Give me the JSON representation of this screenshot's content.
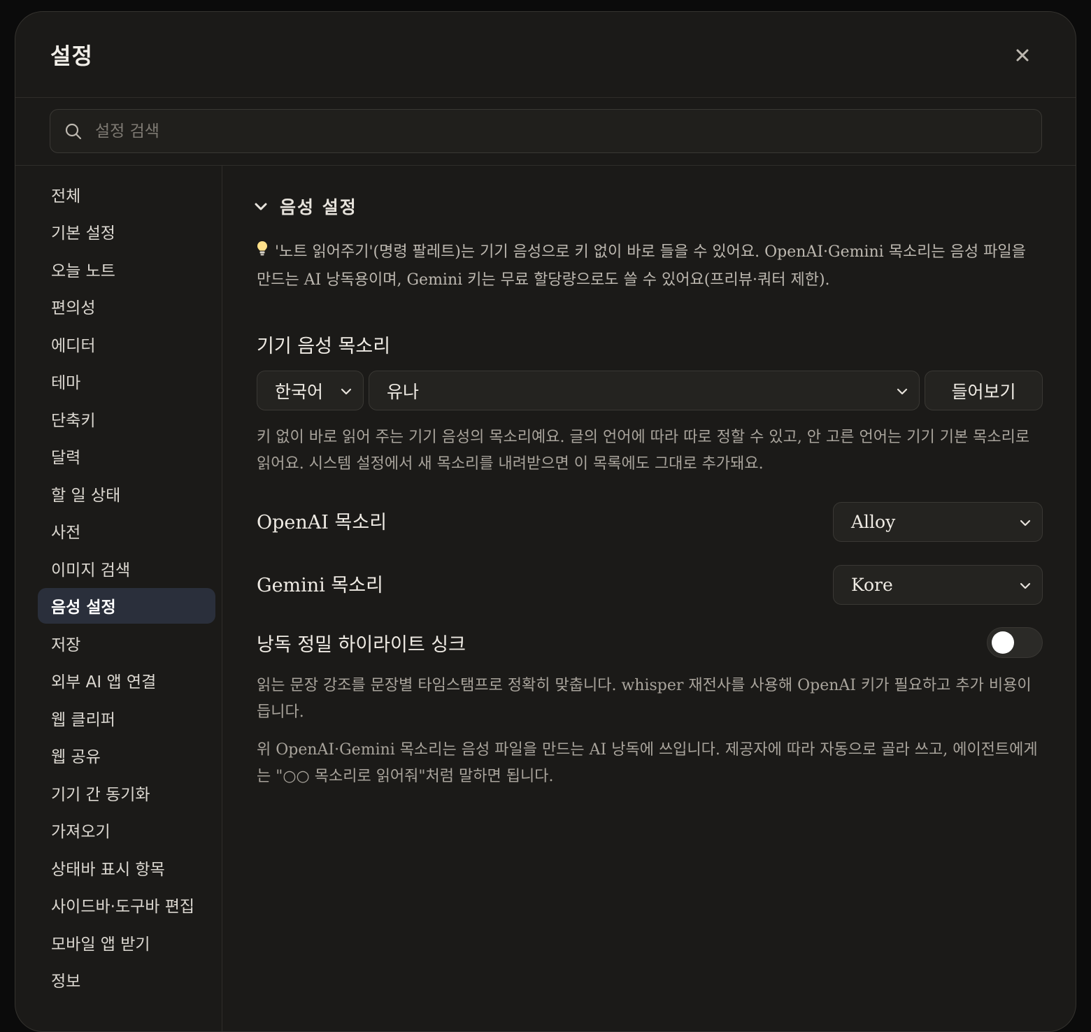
{
  "header": {
    "title": "설정"
  },
  "search": {
    "placeholder": "설정 검색"
  },
  "sidebar": {
    "items": [
      {
        "label": "전체"
      },
      {
        "label": "기본 설정"
      },
      {
        "label": "오늘 노트"
      },
      {
        "label": "편의성"
      },
      {
        "label": "에디터"
      },
      {
        "label": "테마"
      },
      {
        "label": "단축키"
      },
      {
        "label": "달력"
      },
      {
        "label": "할 일 상태"
      },
      {
        "label": "사전"
      },
      {
        "label": "이미지 검색"
      },
      {
        "label": "음성 설정"
      },
      {
        "label": "저장"
      },
      {
        "label": "외부 AI 앱 연결"
      },
      {
        "label": "웹 클리퍼"
      },
      {
        "label": "웹 공유"
      },
      {
        "label": "기기 간 동기화"
      },
      {
        "label": "가져오기"
      },
      {
        "label": "상태바 표시 항목"
      },
      {
        "label": "사이드바·도구바 편집"
      },
      {
        "label": "모바일 앱 받기"
      },
      {
        "label": "정보"
      }
    ],
    "active_index": 11
  },
  "content": {
    "section_title": "음성 설정",
    "tip": "'노트 읽어주기'(명령 팔레트)는 기기 음성으로 키 없이 바로 들을 수 있어요. OpenAI·Gemini 목소리는 음성 파일을 만드는 AI 낭독용이며, Gemini 키는 무료 할당량으로도 쓸 수 있어요(프리뷰·쿼터 제한).",
    "device_voice": {
      "label": "기기 음성 목소리",
      "language": "한국어",
      "voice": "유나",
      "preview_button": "들어보기",
      "description": "키 없이 바로 읽어 주는 기기 음성의 목소리예요. 글의 언어에 따라 따로 정할 수 있고, 안 고른 언어는 기기 기본 목소리로 읽어요. 시스템 설정에서 새 목소리를 내려받으면 이 목록에도 그대로 추가돼요."
    },
    "openai_voice": {
      "label": "OpenAI 목소리",
      "value": "Alloy"
    },
    "gemini_voice": {
      "label": "Gemini 목소리",
      "value": "Kore"
    },
    "highlight_sync": {
      "label": "낭독 정밀 하이라이트 싱크",
      "enabled": false,
      "description": "읽는 문장 강조를 문장별 타임스탬프로 정확히 맞춥니다. whisper 재전사를 사용해 OpenAI 키가 필요하고 추가 비용이 듭니다."
    },
    "footer_note": "위 OpenAI·Gemini 목소리는 음성 파일을 만드는 AI 낭독에 쓰입니다. 제공자에 따라 자동으로 골라 쓰고, 에이전트에게는 \"○○ 목소리로 읽어줘\"처럼 말하면 됩니다."
  },
  "icons": {
    "close": "close-icon",
    "search": "search-icon",
    "collapse": "chevron-down-icon",
    "tip": "lightbulb-icon"
  },
  "colors": {
    "background": "#1b1a18",
    "active_item": "#2a2f3b",
    "toggle_knob": "#ffffff"
  }
}
